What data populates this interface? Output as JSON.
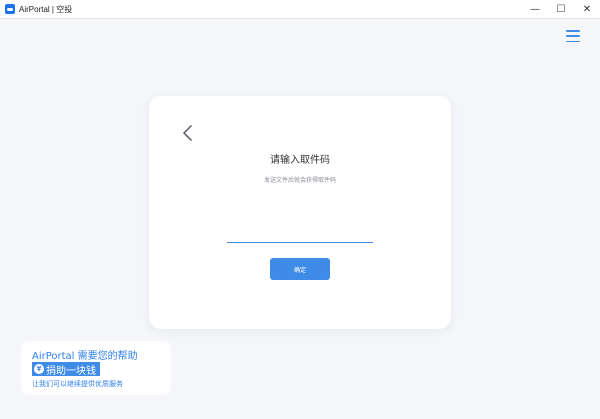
{
  "window": {
    "title": "AirPortal | 空投",
    "minimize_glyph": "—",
    "maximize_glyph": "☐",
    "close_glyph": "✕"
  },
  "header": {
    "menu_icon": "hamburger-menu-icon"
  },
  "card": {
    "back_icon": "chevron-left-icon",
    "title": "请输入取件码",
    "subtitle": "发送文件后就会获得取件码",
    "input_value": "",
    "confirm_label": "确定"
  },
  "donate": {
    "headline": "AirPortal 需要您的帮助",
    "icon_glyph": "¥",
    "action_label": "捐助一块钱",
    "note": "让我们可以继续提供优质服务"
  },
  "colors": {
    "accent": "#3f8ce8",
    "background": "#f4f6f9",
    "card": "#ffffff",
    "text": "#333333",
    "muted": "#8a8f99"
  }
}
